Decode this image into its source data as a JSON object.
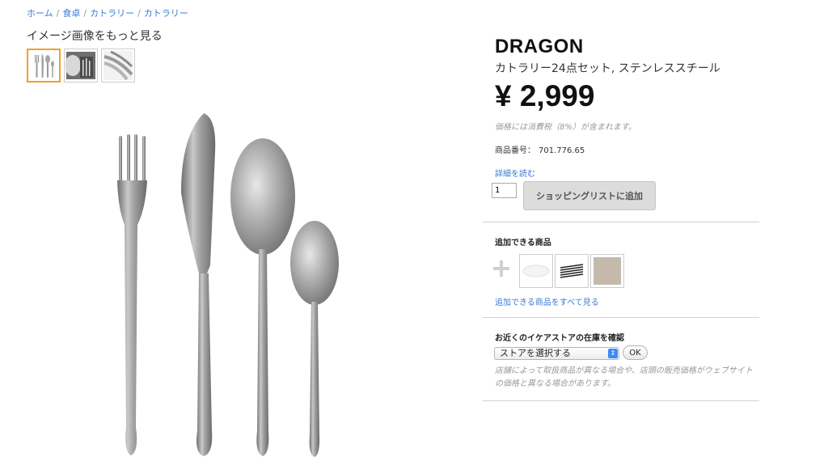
{
  "breadcrumb": {
    "items": [
      "ホーム",
      "食卓",
      "カトラリー",
      "カトラリー"
    ],
    "separator": "/"
  },
  "gallery": {
    "more_images_label": "イメージ画像をもっと見る",
    "thumbnails": [
      "cutlery-set-thumb",
      "cutlery-boxed-thumb",
      "cutlery-closeup-thumb"
    ],
    "selected_index": 0,
    "selected_color": "#f0a030"
  },
  "product": {
    "name": "DRAGON",
    "description": "カトラリー24点セット, ステンレススチール",
    "price": "¥ 2,999",
    "tax_note": "価格には消費税（8%）が含まれます。",
    "article_label": "商品番号：",
    "article_number": "701.776.65",
    "details_link": "詳細を読む",
    "quantity": "1",
    "add_to_list_label": "ショッピングリストに追加"
  },
  "accessories": {
    "title": "追加できる商品",
    "items": [
      "white-plate-icon",
      "cutlery-tray-icon",
      "placemat-icon"
    ],
    "see_all_link": "追加できる商品をすべて見る"
  },
  "store_check": {
    "title": "お近くのイケアストアの在庫を確認",
    "select_value": "ストアを選択する",
    "ok_label": "OK",
    "note": "店舗によって取扱商品が異なる場合や、店頭の販売価格がウェブサイトの価格と異なる場合があります。"
  },
  "colors": {
    "link": "#3a7bd5",
    "select_accent": "#3d8af7"
  }
}
